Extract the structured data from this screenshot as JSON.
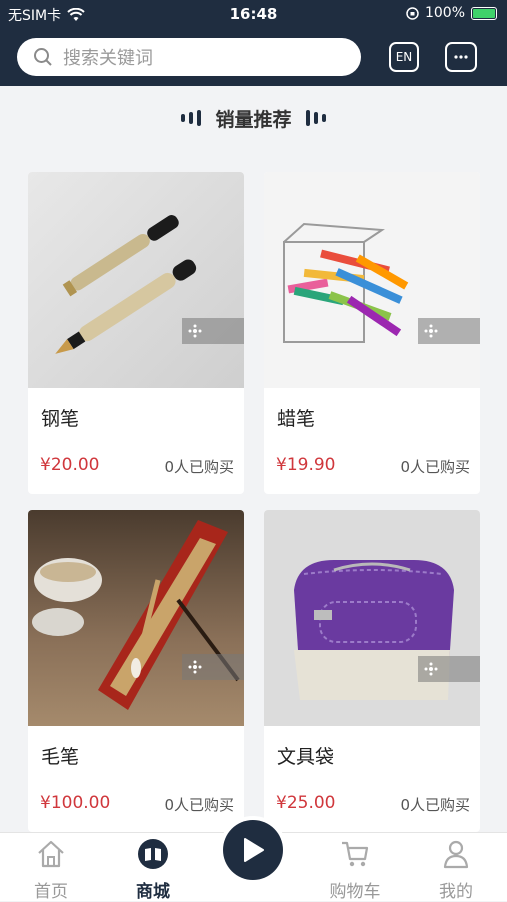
{
  "status_bar": {
    "carrier": "无SIM卡",
    "time": "16:48",
    "battery": "100%"
  },
  "header": {
    "search_placeholder": "搜索关键词",
    "lang_button": "EN"
  },
  "section": {
    "title": "销量推荐"
  },
  "products": [
    {
      "name": "钢笔",
      "price": "¥20.00",
      "sold": "0人已购买"
    },
    {
      "name": "蜡笔",
      "price": "¥19.90",
      "sold": "0人已购买"
    },
    {
      "name": "毛笔",
      "price": "¥100.00",
      "sold": "0人已购买"
    },
    {
      "name": "文具袋",
      "price": "¥25.00",
      "sold": "0人已购买"
    }
  ],
  "tabbar": {
    "items": [
      {
        "label": "首页",
        "icon": "home-icon"
      },
      {
        "label": "商城",
        "icon": "shop-icon",
        "active": true
      },
      {
        "label": "",
        "icon": "play-icon"
      },
      {
        "label": "购物车",
        "icon": "cart-icon"
      },
      {
        "label": "我的",
        "icon": "user-icon"
      }
    ]
  },
  "colors": {
    "header_bg": "#1f2d40",
    "price": "#d0373c",
    "active_tab": "#1f2d40",
    "inactive_tab": "#999999",
    "battery": "#3fd26a"
  }
}
